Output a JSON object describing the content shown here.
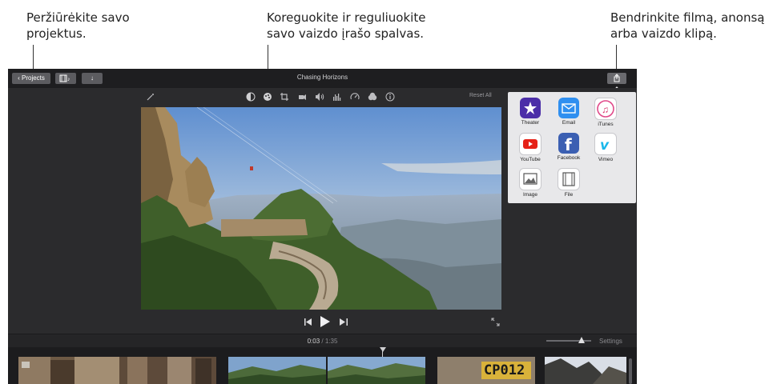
{
  "callouts": {
    "projects": [
      "Peržiūrėkite savo",
      "projektus."
    ],
    "color": [
      "Koreguokite ir reguliuokite",
      "savo vaizdo įrašo spalvas."
    ],
    "share": [
      "Bendrinkite filmą, anonsą",
      "arba vaizdo klipą."
    ]
  },
  "app": {
    "title": "Chasing Horizons",
    "projects_button": "Projects",
    "reset_all": "Reset All",
    "timecode_current": "0:03",
    "timecode_separator": " / ",
    "timecode_total": "1:35",
    "settings": "Settings"
  },
  "adjust_tools": [
    "magic-wand-icon",
    "color-balance-icon",
    "color-correction-icon",
    "crop-icon",
    "stabilization-icon",
    "volume-icon",
    "noise-reduction-icon",
    "speed-icon",
    "filter-icon",
    "info-icon"
  ],
  "share_popover": {
    "items": [
      {
        "label": "Theater",
        "icon": "theater-icon",
        "color": "#4b2ea8"
      },
      {
        "label": "Email",
        "icon": "email-icon",
        "color": "#2f8ff0"
      },
      {
        "label": "iTunes",
        "icon": "itunes-icon",
        "color": "#ffffff"
      },
      {
        "label": "YouTube",
        "icon": "youtube-icon",
        "color": "#ffffff"
      },
      {
        "label": "Facebook",
        "icon": "facebook-icon",
        "color": "#3b5fb2"
      },
      {
        "label": "Vimeo",
        "icon": "vimeo-icon",
        "color": "#ffffff"
      },
      {
        "label": "Image",
        "icon": "image-icon",
        "color": "#ffffff"
      },
      {
        "label": "File",
        "icon": "file-icon",
        "color": "#ffffff"
      }
    ]
  },
  "timeline_clip_text": "CP012",
  "colors": {
    "app_background": "#2b2b2d",
    "titlebar": "#1e1e20",
    "popover": "#e8e8ea",
    "accent_blue": "#2f8ff0"
  }
}
